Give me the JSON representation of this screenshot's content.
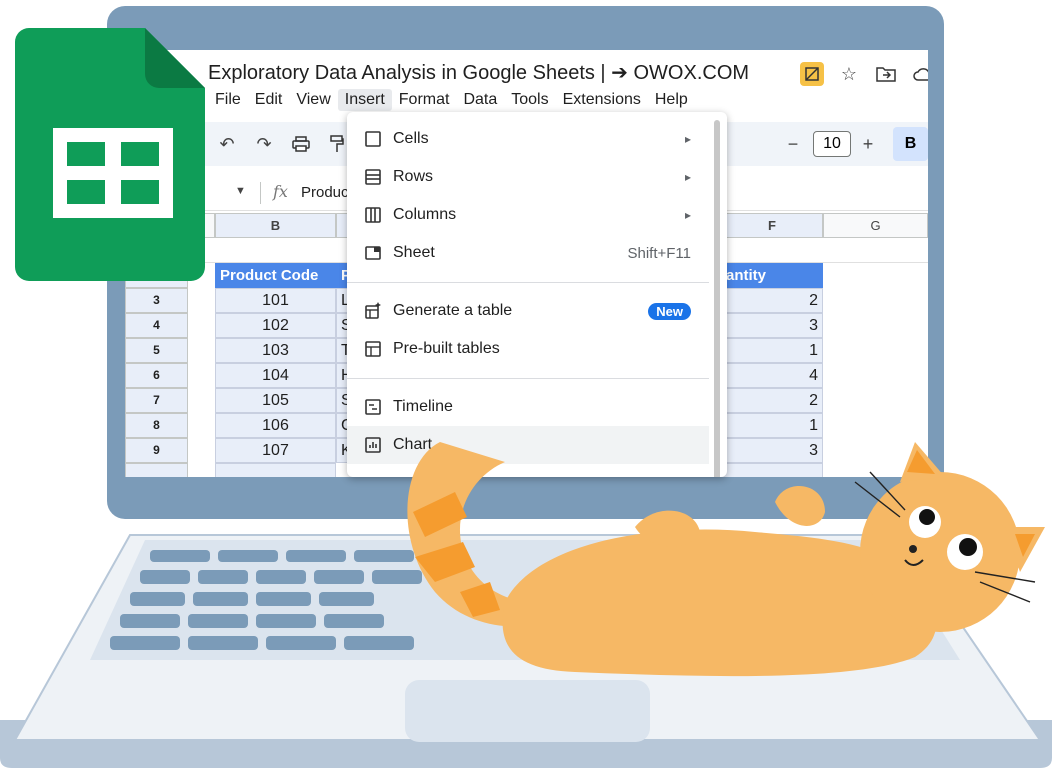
{
  "app": {
    "title": "Exploratory Data Analysis in Google Sheets | ➔ OWOX.COM"
  },
  "menu": [
    "File",
    "Edit",
    "View",
    "Insert",
    "Format",
    "Data",
    "Tools",
    "Extensions",
    "Help"
  ],
  "toolbar": {
    "font_size": "10",
    "minus": "−",
    "plus": "+",
    "bold": "B"
  },
  "formula_bar": {
    "fx": "fx",
    "content": "Produc"
  },
  "columns": [
    "B",
    "F",
    "G"
  ],
  "header_cells": {
    "b": "Product Code",
    "c": "P",
    "f": "antity"
  },
  "rows": [
    {
      "num": "3",
      "code": "101",
      "c": "L",
      "qty": "2"
    },
    {
      "num": "4",
      "code": "102",
      "c": "S",
      "qty": "3"
    },
    {
      "num": "5",
      "code": "103",
      "c": "T",
      "qty": "1"
    },
    {
      "num": "6",
      "code": "104",
      "c": "H",
      "qty": "4"
    },
    {
      "num": "7",
      "code": "105",
      "c": "S",
      "qty": "2"
    },
    {
      "num": "8",
      "code": "106",
      "c": "G",
      "qty": "1"
    },
    {
      "num": "9",
      "code": "107",
      "c": "K",
      "qty": "3"
    }
  ],
  "insert_menu": {
    "items": [
      {
        "label": "Cells",
        "icon": "checkbox-square-icon",
        "right": "▸"
      },
      {
        "label": "Rows",
        "icon": "rows-icon",
        "right": "▸"
      },
      {
        "label": "Columns",
        "icon": "columns-icon",
        "right": "▸"
      },
      {
        "label": "Sheet",
        "icon": "sheet-icon",
        "right": "Shift+F11"
      },
      {
        "label": "Generate a table",
        "icon": "generate-table-icon",
        "badge": "New"
      },
      {
        "label": "Pre-built tables",
        "icon": "table-icon"
      },
      {
        "label": "Timeline",
        "icon": "timeline-icon"
      },
      {
        "label": "Chart",
        "icon": "chart-icon"
      }
    ]
  },
  "colors": {
    "sheets_green": "#0f9d58",
    "header_blue": "#4a86e8",
    "cat_orange": "#f6b865",
    "laptop_blue": "#7b9bb8"
  }
}
